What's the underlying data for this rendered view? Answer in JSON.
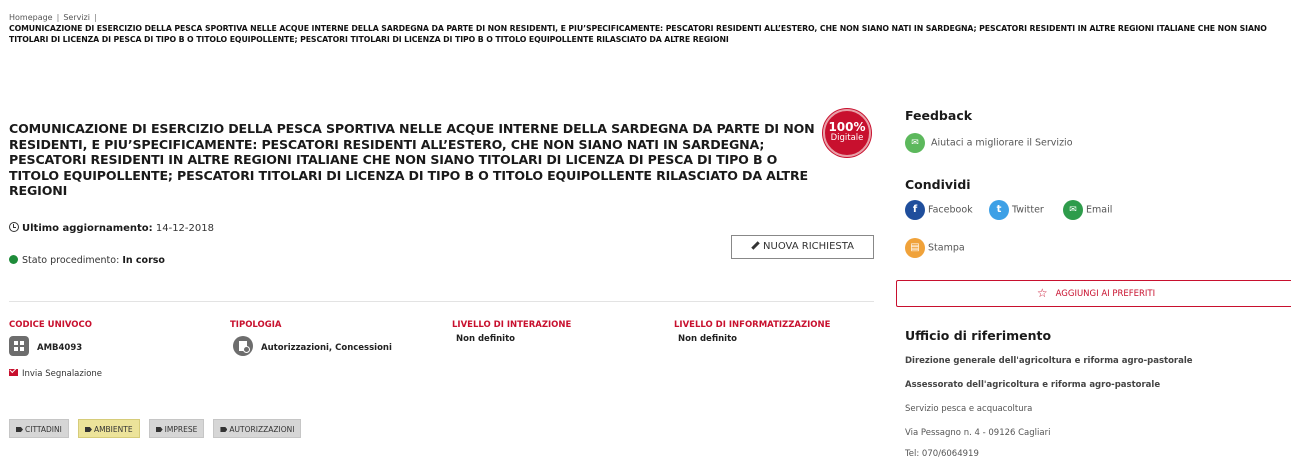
{
  "breadcrumb": {
    "home": "Homepage",
    "servizi": "Servizi",
    "current": "COMUNICAZIONE DI ESERCIZIO DELLA PESCA SPORTIVA NELLE ACQUE INTERNE DELLA SARDEGNA DA PARTE DI NON RESIDENTI, E PIU’SPECIFICAMENTE: PESCATORI RESIDENTI ALL’ESTERO, CHE NON SIANO NATI IN SARDEGNA; PESCATORI RESIDENTI IN ALTRE REGIONI ITALIANE CHE NON SIANO TITOLARI DI LICENZA DI PESCA DI TIPO B O TITOLO EQUIPOLLENTE; PESCATORI TITOLARI DI LICENZA DI TIPO B O TITOLO EQUIPOLLENTE RILASCIATO DA ALTRE REGIONI"
  },
  "service": {
    "title": "COMUNICAZIONE DI ESERCIZIO DELLA PESCA SPORTIVA NELLE ACQUE INTERNE DELLA SARDEGNA DA PARTE DI NON RESIDENTI, E PIU’SPECIFICAMENTE: PESCATORI RESIDENTI ALL’ESTERO, CHE NON SIANO NATI IN SARDEGNA; PESCATORI RESIDENTI IN ALTRE REGIONI ITALIANE CHE NON SIANO TITOLARI DI LICENZA DI PESCA DI TIPO B O TITOLO EQUIPOLLENTE; PESCATORI TITOLARI DI LICENZA DI TIPO B O TITOLO EQUIPOLLENTE RILASCIATO DA ALTRE REGIONI",
    "badge_main": "100%",
    "badge_sub": "Digitale",
    "updated_label": "Ultimo aggiornamento:",
    "updated_value": "14-12-2018",
    "status_label": "Stato procedimento:",
    "status_value": "In corso",
    "new_request_label": "NUOVA RICHIESTA",
    "report_label": "Invia Segnalazione"
  },
  "info_columns": [
    {
      "header": "CODICE UNIVOCO",
      "value": "AMB4093",
      "icon": "qr-code-icon"
    },
    {
      "header": "TIPOLOGIA",
      "value": "Autorizzazioni, Concessioni",
      "icon": "document-icon"
    },
    {
      "header": "LIVELLO DI INTERAZIONE",
      "value": "Non definito"
    },
    {
      "header": "LIVELLO DI INFORMATIZZAZIONE",
      "value": "Non definito"
    }
  ],
  "tags": [
    "CITTADINI",
    "AMBIENTE",
    "IMPRESE",
    "AUTORIZZAZIONI"
  ],
  "sidebar": {
    "feedback_title": "Feedback",
    "feedback_link": "Aiutaci a migliorare il Servizio",
    "share_title": "Condividi",
    "share_facebook": "Facebook",
    "share_twitter": "Twitter",
    "share_email": "Email",
    "share_print": "Stampa",
    "favorites_label": "AGGIUNGI AI PREFERITI",
    "office_title": "Ufficio di riferimento",
    "office_lines": [
      "Direzione generale dell'agricoltura e riforma agro-pastorale",
      "Assessorato dell'agricoltura e riforma agro-pastorale",
      "Servizio pesca e acquacoltura",
      "Via Pessagno n. 4 - 09126 Cagliari",
      "Tel: 070/6064919"
    ]
  },
  "colors": {
    "accent_red": "#c8102e",
    "status_green": "#1e8c3a",
    "feedback_green": "#5cb85c",
    "facebook_blue": "#1f4e9c",
    "twitter_blue": "#3da0e6",
    "email_green": "#2e9c4b",
    "print_orange": "#f0a23a",
    "tag_highlight": "#ece39a"
  }
}
